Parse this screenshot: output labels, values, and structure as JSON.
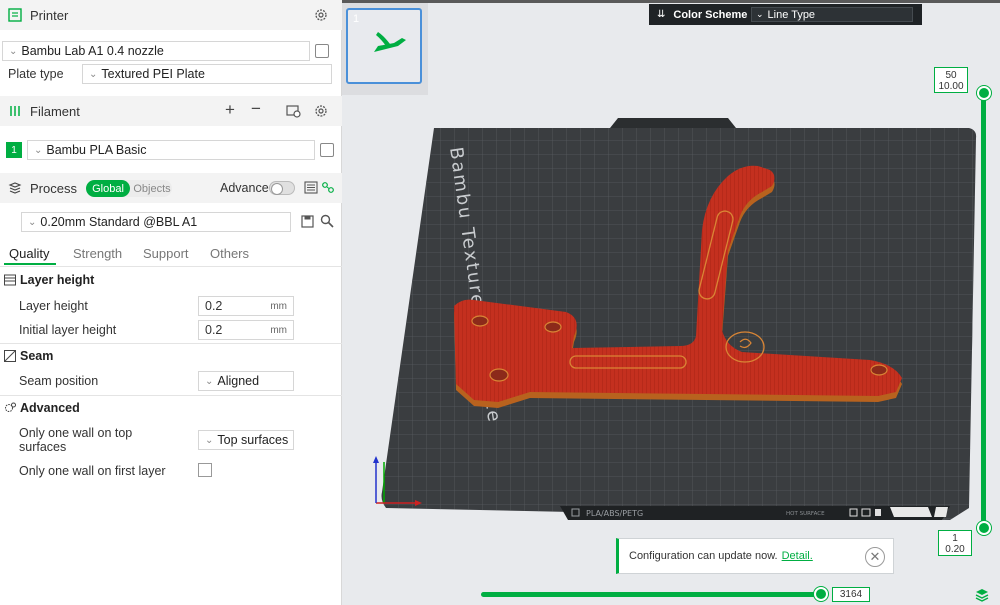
{
  "printer": {
    "header": "Printer",
    "model": "Bambu Lab A1 0.4 nozzle",
    "plate_type_label": "Plate type",
    "plate_type_value": "Textured PEI Plate"
  },
  "filament": {
    "header": "Filament",
    "slot_number": "1",
    "slot_color": "#00ae42",
    "value": "Bambu PLA Basic"
  },
  "process": {
    "header": "Process",
    "toggle_global": "Global",
    "toggle_objects": "Objects",
    "advance_label": "Advance",
    "preset": "0.20mm Standard @BBL A1"
  },
  "tabs": [
    "Quality",
    "Strength",
    "Support",
    "Others"
  ],
  "quality": {
    "layer_group": "Layer height",
    "layer_height_label": "Layer height",
    "layer_height_value": "0.2",
    "initial_layer_label": "Initial layer height",
    "initial_layer_value": "0.2",
    "unit": "mm",
    "seam_group": "Seam",
    "seam_position_label": "Seam position",
    "seam_position_value": "Aligned",
    "advanced_group": "Advanced",
    "one_wall_top_label": "Only one wall on top surfaces",
    "one_wall_top_value": "Top surfaces",
    "one_wall_first_label": "Only one wall on first layer"
  },
  "viewport": {
    "thumbnail_number": "1",
    "color_scheme_label": "Color Scheme",
    "color_scheme_value": "Line Type",
    "bed_text": "Bambu Textured PEI Plate",
    "bed_tag_filament": "PLA/ABS/PETG",
    "bed_tag_hot": "HOT SURFACE",
    "layer_top_num": "50",
    "layer_top_height": "10.00",
    "layer_bottom_num": "1",
    "layer_bottom_height": "0.20",
    "horizontal_slider_value": "3164",
    "notice_text": "Configuration can update now.",
    "notice_link": "Detail."
  },
  "colors": {
    "accent": "#00ae42",
    "model": "#c4301f",
    "bed": "#3a3d40"
  }
}
